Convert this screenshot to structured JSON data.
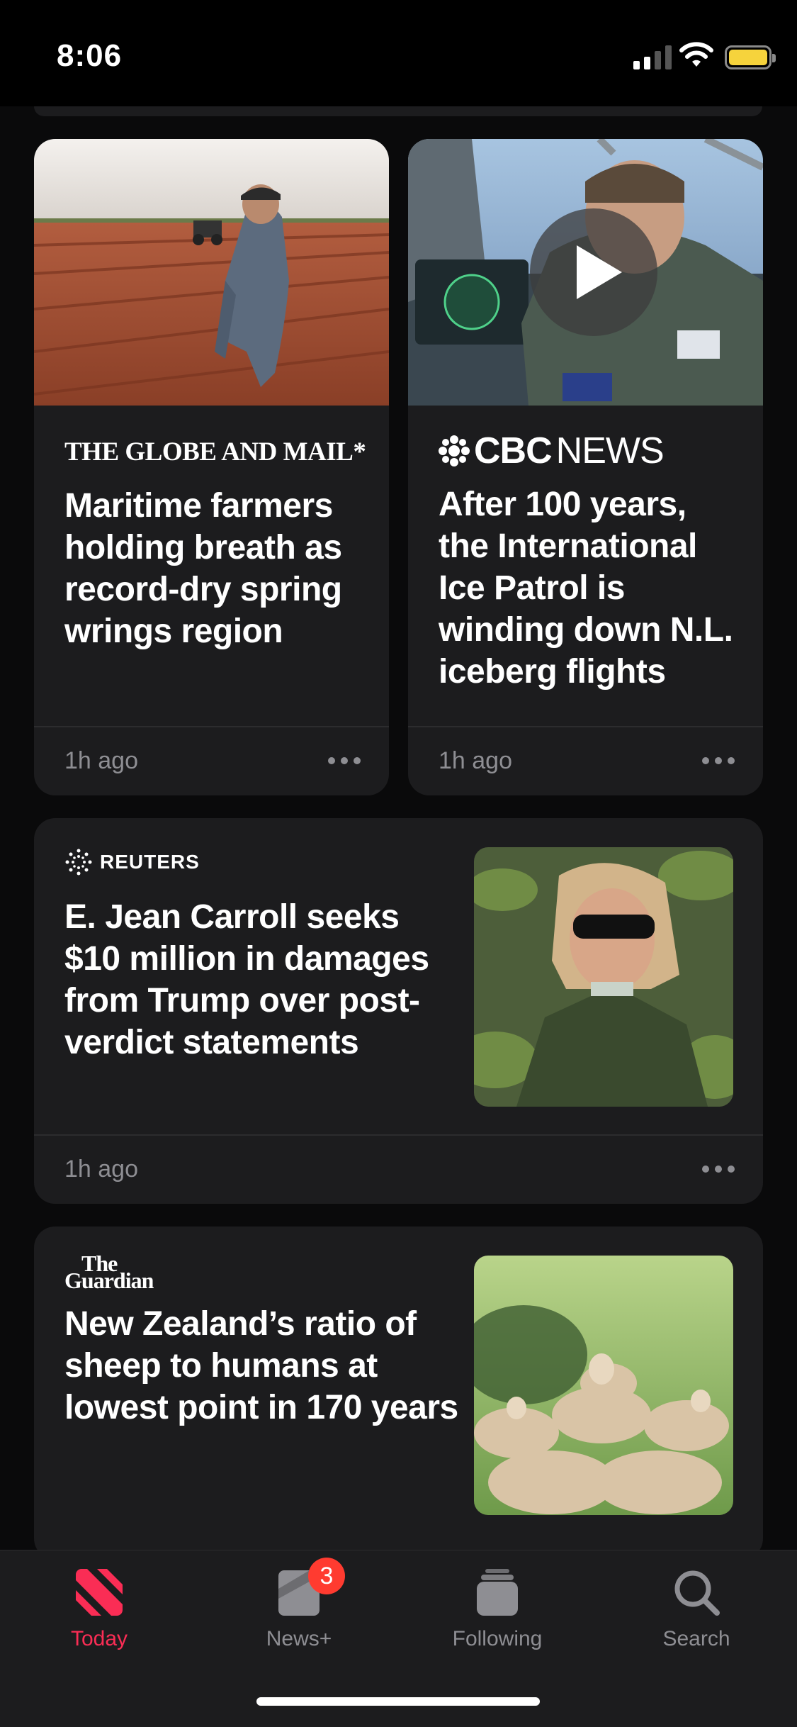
{
  "status_bar": {
    "time": "8:06"
  },
  "cards": [
    {
      "publisher": "THE GLOBE AND MAIL*",
      "headline": "Maritime farmers holding breath as record-dry spring wrings region",
      "time_ago": "1h ago"
    },
    {
      "publisher_bold": "CBC",
      "publisher_light": "NEWS",
      "headline": "After 100 years, the International Ice Patrol is winding down N.L. iceberg flights",
      "time_ago": "1h ago"
    },
    {
      "publisher": "REUTERS",
      "headline": "E. Jean Carroll seeks $10 million in damages from Trump over post-verdict statements",
      "time_ago": "1h ago"
    },
    {
      "publisher_line1": "The",
      "publisher_line2": "Guardian",
      "headline": "New Zealand’s ratio of sheep to humans at lowest point in 170 years"
    }
  ],
  "tab_bar": {
    "tabs": [
      {
        "label": "Today",
        "icon": "news-logo-icon",
        "active": true
      },
      {
        "label": "News+",
        "icon": "news-plus-icon",
        "badge": "3"
      },
      {
        "label": "Following",
        "icon": "following-icon"
      },
      {
        "label": "Search",
        "icon": "search-icon"
      }
    ]
  },
  "colors": {
    "accent": "#fa2d55",
    "badge": "#ff3b30",
    "card": "#1c1c1e",
    "background": "#0a0a0b"
  }
}
